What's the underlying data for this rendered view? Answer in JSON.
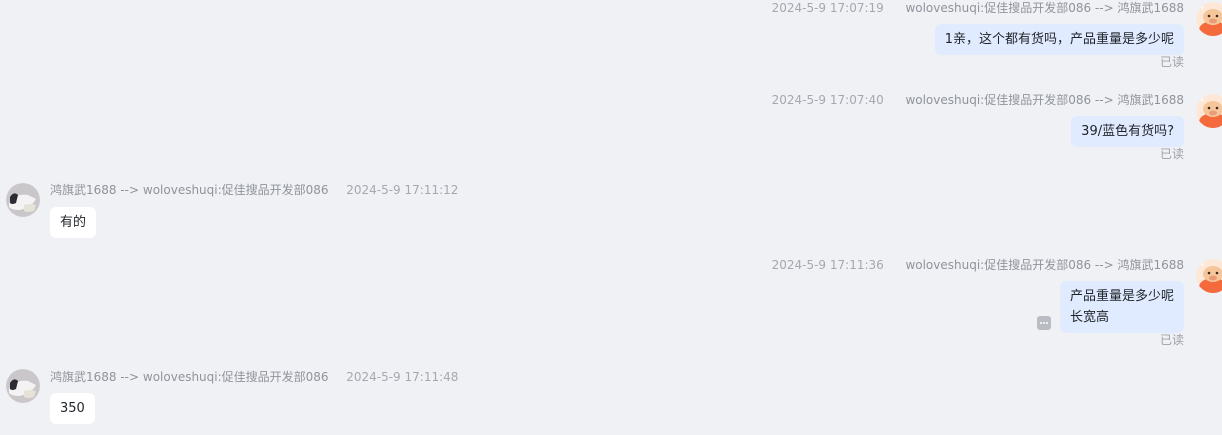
{
  "messages": [
    {
      "direction": "outgoing",
      "timestamp": "2024-5-9 17:07:19",
      "sender": "woloveshuqi:促佳搜品开发部086 --> 鸿旗武1688",
      "lines": [
        "1亲，这个都有货吗，产品重量是多少呢"
      ],
      "read_status": "已读"
    },
    {
      "direction": "outgoing",
      "timestamp": "2024-5-9 17:07:40",
      "sender": "woloveshuqi:促佳搜品开发部086 --> 鸿旗武1688",
      "lines": [
        "39/蓝色有货吗?"
      ],
      "read_status": "已读"
    },
    {
      "direction": "incoming",
      "timestamp": "2024-5-9 17:11:12",
      "sender": "鸿旗武1688 --> woloveshuqi:促佳搜品开发部086",
      "lines": [
        "有的"
      ]
    },
    {
      "direction": "outgoing",
      "timestamp": "2024-5-9 17:11:36",
      "sender": "woloveshuqi:促佳搜品开发部086 --> 鸿旗武1688",
      "lines": [
        "产品重量是多少呢",
        "长宽高"
      ],
      "read_status": "已读",
      "has_more_icon": true
    },
    {
      "direction": "incoming",
      "timestamp": "2024-5-9 17:11:48",
      "sender": "鸿旗武1688 --> woloveshuqi:促佳搜品开发部086",
      "lines": [
        "350"
      ]
    }
  ],
  "icons": {
    "outgoing_avatar": "cartoon-cow-avatar-icon",
    "incoming_avatar": "shoe-photo-avatar-icon",
    "more": "more-dots-icon"
  },
  "colors": {
    "background": "#f0f1f5",
    "outgoing_bubble": "#e1ebff",
    "incoming_bubble": "#ffffff",
    "meta_text": "#a5a8b0",
    "avatar_orange": "#f46a3c"
  }
}
